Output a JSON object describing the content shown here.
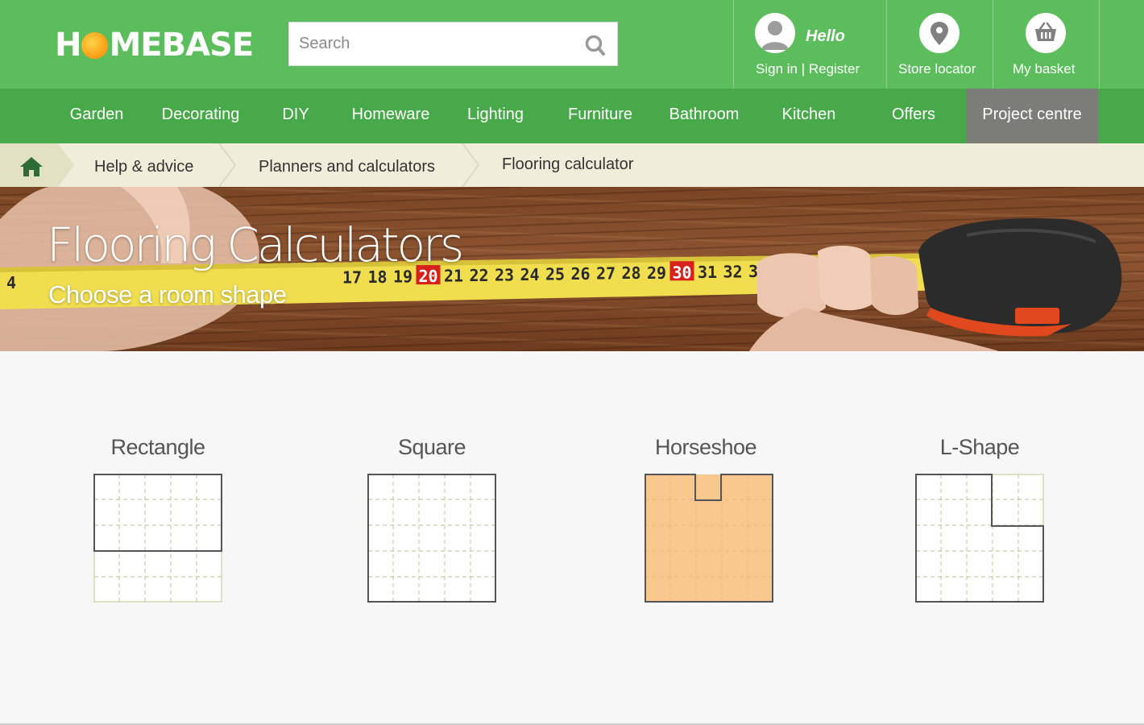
{
  "brand": {
    "logo_left": "H",
    "logo_right": "MEBASE"
  },
  "search": {
    "placeholder": "Search"
  },
  "account": {
    "greeting": "Hello",
    "sign_in": "Sign in | Register"
  },
  "store_locator": {
    "label": "Store locator"
  },
  "basket": {
    "label": "My basket"
  },
  "nav": {
    "items": [
      {
        "label": "Garden"
      },
      {
        "label": "Decorating"
      },
      {
        "label": "DIY"
      },
      {
        "label": "Homeware"
      },
      {
        "label": "Lighting"
      },
      {
        "label": "Furniture"
      },
      {
        "label": "Bathroom"
      },
      {
        "label": "Kitchen"
      },
      {
        "label": "Offers"
      },
      {
        "label": "Project centre"
      }
    ]
  },
  "breadcrumb": {
    "items": [
      {
        "label": "Help & advice"
      },
      {
        "label": "Planners and calculators"
      },
      {
        "label": "Flooring calculator"
      }
    ]
  },
  "hero": {
    "title": "Flooring Calculators",
    "subtitle": "Choose a room shape",
    "tape_numbers": [
      "4",
      "17",
      "18",
      "19",
      "20",
      "21",
      "22",
      "23",
      "24",
      "25",
      "26",
      "27",
      "28",
      "29",
      "30",
      "31",
      "32",
      "33"
    ]
  },
  "shapes": [
    {
      "label": "Rectangle",
      "selected": false
    },
    {
      "label": "Square",
      "selected": false
    },
    {
      "label": "Horseshoe",
      "selected": true
    },
    {
      "label": "L-Shape",
      "selected": false
    }
  ],
  "colors": {
    "header_green": "#5cbd5c",
    "nav_green": "#48a94a",
    "active_nav": "#7d7d78",
    "breadcrumb_bg": "#efeedb",
    "selected_fill": "#f9c88f",
    "home_icon": "#2f6b35"
  }
}
